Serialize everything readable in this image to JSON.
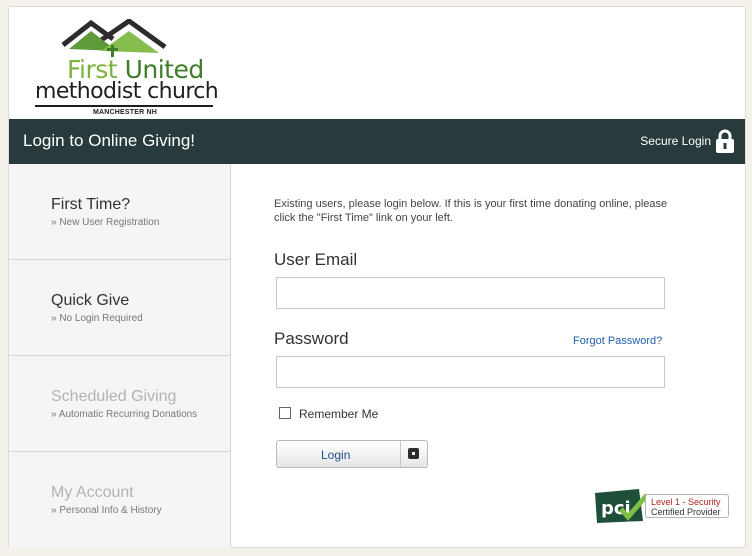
{
  "logo": {
    "line1_first": "First",
    "line1_rest": "United",
    "line2": "methodist church",
    "line3": "MANCHESTER NH"
  },
  "header": {
    "title": "Login to Online Giving!",
    "secure_label": "Secure Login",
    "secure_icon": "lock-icon"
  },
  "sidebar": {
    "items": [
      {
        "title": "First Time?",
        "subtitle": "» New User Registration"
      },
      {
        "title": "Quick Give",
        "subtitle": "» No Login Required"
      },
      {
        "title": "Scheduled Giving",
        "subtitle": "» Automatic Recurring Donations"
      },
      {
        "title": "My Account",
        "subtitle": "» Personal Info & History"
      }
    ]
  },
  "main": {
    "intro": "Existing users, please login below. If this is your first time donating online, please click the \"First Time\" link on your left.",
    "email_label": "User Email",
    "email_value": "",
    "password_label": "Password",
    "password_value": "",
    "forgot_label": "Forgot Password?",
    "remember_label": "Remember Me",
    "login_label": "Login"
  },
  "pci": {
    "badge_text": "pci",
    "line1": "Level 1 - Security",
    "line2": "Certified Provider"
  },
  "colors": {
    "header_bg": "#283a3b",
    "brand_green": "#3f7d2b",
    "link_blue": "#1f5fa8"
  }
}
